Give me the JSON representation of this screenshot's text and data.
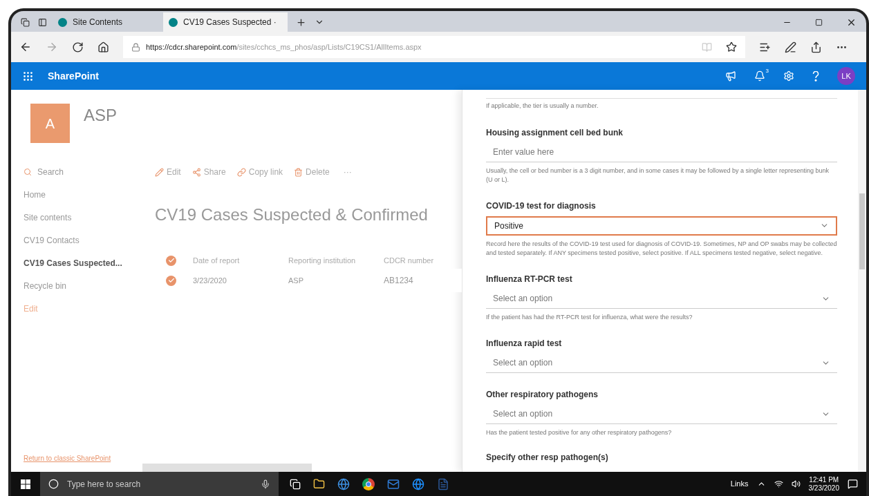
{
  "browser": {
    "tabs": [
      {
        "title": "Site Contents",
        "selected": false
      },
      {
        "title": "CV19 Cases Suspected ·",
        "selected": true
      }
    ],
    "url_host": "https://cdcr.sharepoint.com",
    "url_path": "/sites/cchcs_ms_phos/asp/Lists/C19CS1/AllItems.aspx"
  },
  "suite_bar": {
    "app": "SharePoint",
    "notification_count": "3",
    "avatar": "LK"
  },
  "site": {
    "logo_letter": "A",
    "name": "ASP"
  },
  "nav": {
    "search": "Search",
    "items": [
      {
        "label": "Home",
        "selected": false
      },
      {
        "label": "Site contents",
        "selected": false
      },
      {
        "label": "CV19 Contacts",
        "selected": false
      },
      {
        "label": "CV19 Cases Suspected...",
        "selected": true
      },
      {
        "label": "Recycle bin",
        "selected": false
      }
    ],
    "edit": "Edit",
    "return_link": "Return to classic SharePoint"
  },
  "command_bar": [
    {
      "kind": "edit",
      "label": "Edit"
    },
    {
      "kind": "share",
      "label": "Share"
    },
    {
      "kind": "link",
      "label": "Copy link"
    },
    {
      "kind": "delete",
      "label": "Delete"
    },
    {
      "kind": "more",
      "label": "···"
    }
  ],
  "list": {
    "title": "CV19 Cases Suspected & Confirmed",
    "all_selected": true,
    "columns": [
      "Date of report",
      "Reporting institution",
      "CDCR number"
    ],
    "rows": [
      {
        "selected": true,
        "cells": [
          "3/23/2020",
          "ASP",
          "AB1234"
        ]
      }
    ]
  },
  "form": {
    "top_hint": "If applicable, the tier is usually a number.",
    "fields": [
      {
        "kind": "text",
        "label": "Housing assignment cell bed bunk",
        "placeholder": "Enter value here",
        "focused": false,
        "hint": "Usually, the cell or bed number is a 3 digit number, and in some cases it may be followed by a single letter representing bunk (U or L)."
      },
      {
        "kind": "choice",
        "label": "COVID-19 test for diagnosis",
        "value": "Positive",
        "focused": true,
        "hint": "Record here the results of the COVID-19 test used for diagnosis of COVID-19. Sometimes, NP and OP swabs may be collected and tested separately. If ANY specimens tested positive, select positive. If ALL specimens tested negative, select negative."
      },
      {
        "kind": "choice",
        "label": "Influenza RT-PCR test",
        "placeholder": "Select an option",
        "focused": false,
        "hint": "If the patient has had the RT-PCR test for influenza, what were the results?"
      },
      {
        "kind": "choice",
        "label": "Influenza rapid test",
        "placeholder": "Select an option",
        "focused": false
      },
      {
        "kind": "choice",
        "label": "Other respiratory pathogens",
        "placeholder": "Select an option",
        "focused": false,
        "hint": "Has the patient tested positive for any other respiratory pathogens?"
      },
      {
        "kind": "heading",
        "label": "Specify other resp pathogen(s)"
      }
    ]
  },
  "taskbar": {
    "search_placeholder": "Type here to search",
    "links": "Links",
    "time": "12:41 PM",
    "date": "3/23/2020"
  }
}
